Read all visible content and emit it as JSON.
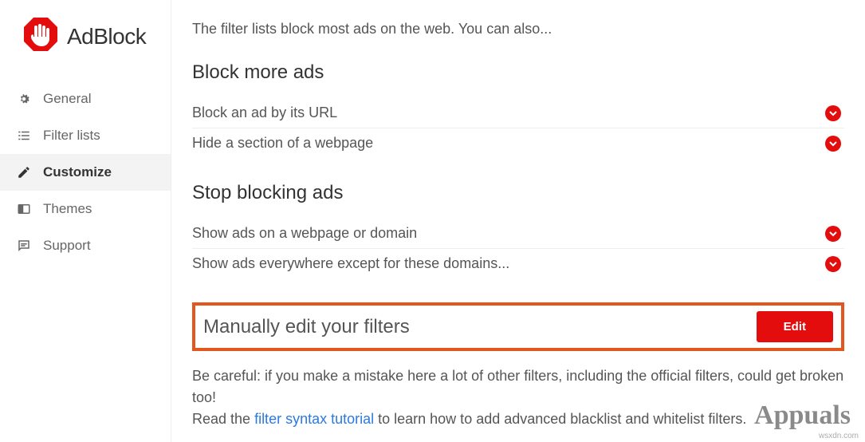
{
  "brand": {
    "name": "AdBlock"
  },
  "sidebar": {
    "items": [
      {
        "label": "General"
      },
      {
        "label": "Filter lists"
      },
      {
        "label": "Customize"
      },
      {
        "label": "Themes"
      },
      {
        "label": "Support"
      }
    ]
  },
  "intro": "The filter lists block most ads on the web. You can also...",
  "block_more": {
    "title": "Block more ads",
    "rows": [
      "Block an ad by its URL",
      "Hide a section of a webpage"
    ]
  },
  "stop_blocking": {
    "title": "Stop blocking ads",
    "rows": [
      "Show ads on a webpage or domain",
      "Show ads everywhere except for these domains..."
    ]
  },
  "manual": {
    "title": "Manually edit your filters",
    "button": "Edit"
  },
  "footer": {
    "line1": "Be careful: if you make a mistake here a lot of other filters, including the official filters, could get broken too!",
    "line2_prefix": "Read the ",
    "line2_link": "filter syntax tutorial",
    "line2_suffix": " to learn how to add advanced blacklist and whitelist filters."
  },
  "watermark": "Appuals",
  "watermark_small": "wsxdn.com"
}
